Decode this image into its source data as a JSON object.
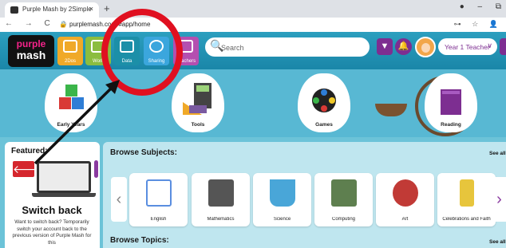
{
  "browser": {
    "tab_title": "Purple Mash by 2Simple",
    "tab_close": "×",
    "new_tab": "+",
    "url": "purplemash.com/#app/home",
    "nav_icons": "← → C ⌂",
    "lock_icon": "🔒",
    "addr_right": [
      "⊶",
      "☆",
      "👤"
    ],
    "win_controls": [
      "●",
      "–",
      "⧉"
    ]
  },
  "header": {
    "logo_top": "purple",
    "logo_bottom": "mash",
    "nav": [
      {
        "label": "2Dos",
        "color": "#f0a928"
      },
      {
        "label": "Work",
        "color": "#8bbd3f"
      },
      {
        "label": "Data",
        "color": "#1c8fa8"
      },
      {
        "label": "Sharing",
        "color": "#3ba6dd"
      },
      {
        "label": "Teachers",
        "color": "#b44fb0"
      }
    ],
    "search_placeholder": "Search",
    "search_icon": "🔍",
    "filter_icon": "▼",
    "bell_icon": "🔔",
    "user_label": "Year 1 Teacher",
    "user_chevron": "∨"
  },
  "categories": [
    {
      "label": "Early Years",
      "accent": "#2e7dd6"
    },
    {
      "label": "Tools",
      "accent": "#7a5aa0"
    },
    {
      "label": "Games",
      "accent": "#222222"
    },
    {
      "label": "Reading",
      "accent": "#7d2e91"
    }
  ],
  "featured": {
    "title": "Featured:",
    "arrow": "🡐",
    "heading": "Switch back",
    "description": "Want to switch back? Temporarily switch your account back to the previous version of Purple Mash for this"
  },
  "browse": {
    "subjects_title": "Browse Subjects:",
    "topics_title": "Browse Topics:",
    "see_all": "See all",
    "prev": "‹",
    "next": "›",
    "subjects": [
      {
        "label": "English",
        "art": "#5a8ee0"
      },
      {
        "label": "Mathematics",
        "art": "#555555"
      },
      {
        "label": "Science",
        "art": "#49a6d8"
      },
      {
        "label": "Computing",
        "art": "#5e7f4f"
      },
      {
        "label": "Art",
        "art": "#c13a36"
      },
      {
        "label": "Celebrations and Faith",
        "art": "#e7c53c"
      }
    ]
  }
}
